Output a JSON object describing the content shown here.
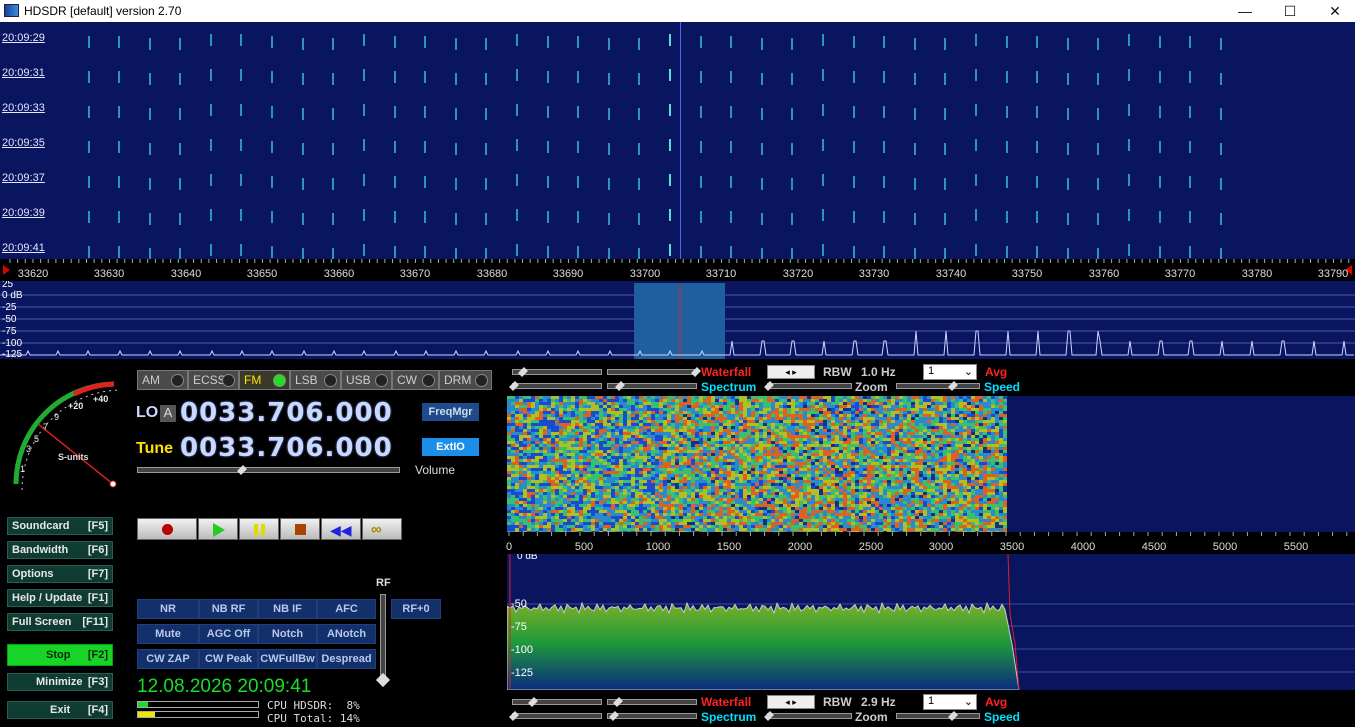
{
  "titlebar": {
    "title": "HDSDR [default]  version 2.70",
    "min": "—",
    "max": "☐",
    "close": "✕"
  },
  "waterfall_top": {
    "timestamps": [
      "20:09:29",
      "20:09:31",
      "20:09:33",
      "20:09:35",
      "20:09:37",
      "20:09:39",
      "20:09:41"
    ]
  },
  "freq_axis": {
    "ticks": [
      "33620",
      "33630",
      "33640",
      "33650",
      "33660",
      "33670",
      "33680",
      "33690",
      "33700",
      "33710",
      "33720",
      "33730",
      "33740",
      "33750",
      "33760",
      "33770",
      "33780",
      "33790"
    ]
  },
  "spectrum_top": {
    "db_labels": [
      "25",
      "0 dB",
      "-25",
      "-50",
      "-75",
      "-100",
      "-125"
    ]
  },
  "smeter": {
    "label": "S-units",
    "marks": [
      "1",
      "3",
      "5",
      "7",
      "9",
      "+20",
      "+40"
    ]
  },
  "modes": [
    {
      "label": "AM",
      "active": false
    },
    {
      "label": "ECSS",
      "active": false
    },
    {
      "label": "FM",
      "active": true
    },
    {
      "label": "LSB",
      "active": false
    },
    {
      "label": "USB",
      "active": false
    },
    {
      "label": "CW",
      "active": false
    },
    {
      "label": "DRM",
      "active": false
    }
  ],
  "lo": {
    "label": "LO",
    "badge": "A",
    "value": "0033.706.000"
  },
  "tune": {
    "label": "Tune",
    "value": "0033.706.000"
  },
  "buttons": {
    "freqmgr": "FreqMgr",
    "extio": "ExtIO",
    "volume": "Volume",
    "rf": "RF",
    "rf0": "RF+0"
  },
  "sidebar": [
    {
      "label": "Soundcard",
      "key": "[F5]"
    },
    {
      "label": "Bandwidth",
      "key": "[F6]"
    },
    {
      "label": "Options",
      "key": "[F7]"
    },
    {
      "label": "Help / Update",
      "key": "[F1]"
    },
    {
      "label": "Full Screen",
      "key": "[F11]"
    },
    {
      "label": "Stop",
      "key": "[F2]"
    },
    {
      "label": "Minimize",
      "key": "[F3]"
    },
    {
      "label": "Exit",
      "key": "[F4]"
    }
  ],
  "dsp": [
    "NR",
    "NB RF",
    "NB IF",
    "AFC",
    "Mute",
    "AGC Off",
    "Notch",
    "ANotch",
    "CW ZAP",
    "CW Peak",
    "CWFullBw",
    "Despread"
  ],
  "status": {
    "datetime": "12.08.2026 20:09:41",
    "cpu_hdsdr": "CPU HDSDR:  8%",
    "cpu_total": "CPU Total: 14%"
  },
  "top_controls": {
    "waterfall": "Waterfall",
    "spectrum": "Spectrum",
    "rbw_label": "RBW",
    "rbw_value": "1.0 Hz",
    "zoom": "Zoom",
    "avg": "Avg",
    "speed": "Speed",
    "select": "1"
  },
  "bottom_controls": {
    "waterfall": "Waterfall",
    "spectrum": "Spectrum",
    "rbw_label": "RBW",
    "rbw_value": "2.9 Hz",
    "zoom": "Zoom",
    "avg": "Avg",
    "speed": "Speed",
    "select": "1"
  },
  "af_axis": {
    "ticks": [
      "0",
      "500",
      "1000",
      "1500",
      "2000",
      "2500",
      "3000",
      "3500",
      "4000",
      "4500",
      "5000",
      "5500"
    ]
  },
  "af_spectrum": {
    "db_labels": [
      "0 dB",
      "-50",
      "-75",
      "-100",
      "-125"
    ]
  },
  "colors": {
    "bg_plot": "#0a1560",
    "accent_red": "#ff2020",
    "accent_cyan": "#00e0ff",
    "green_active": "#1bdc2a"
  }
}
